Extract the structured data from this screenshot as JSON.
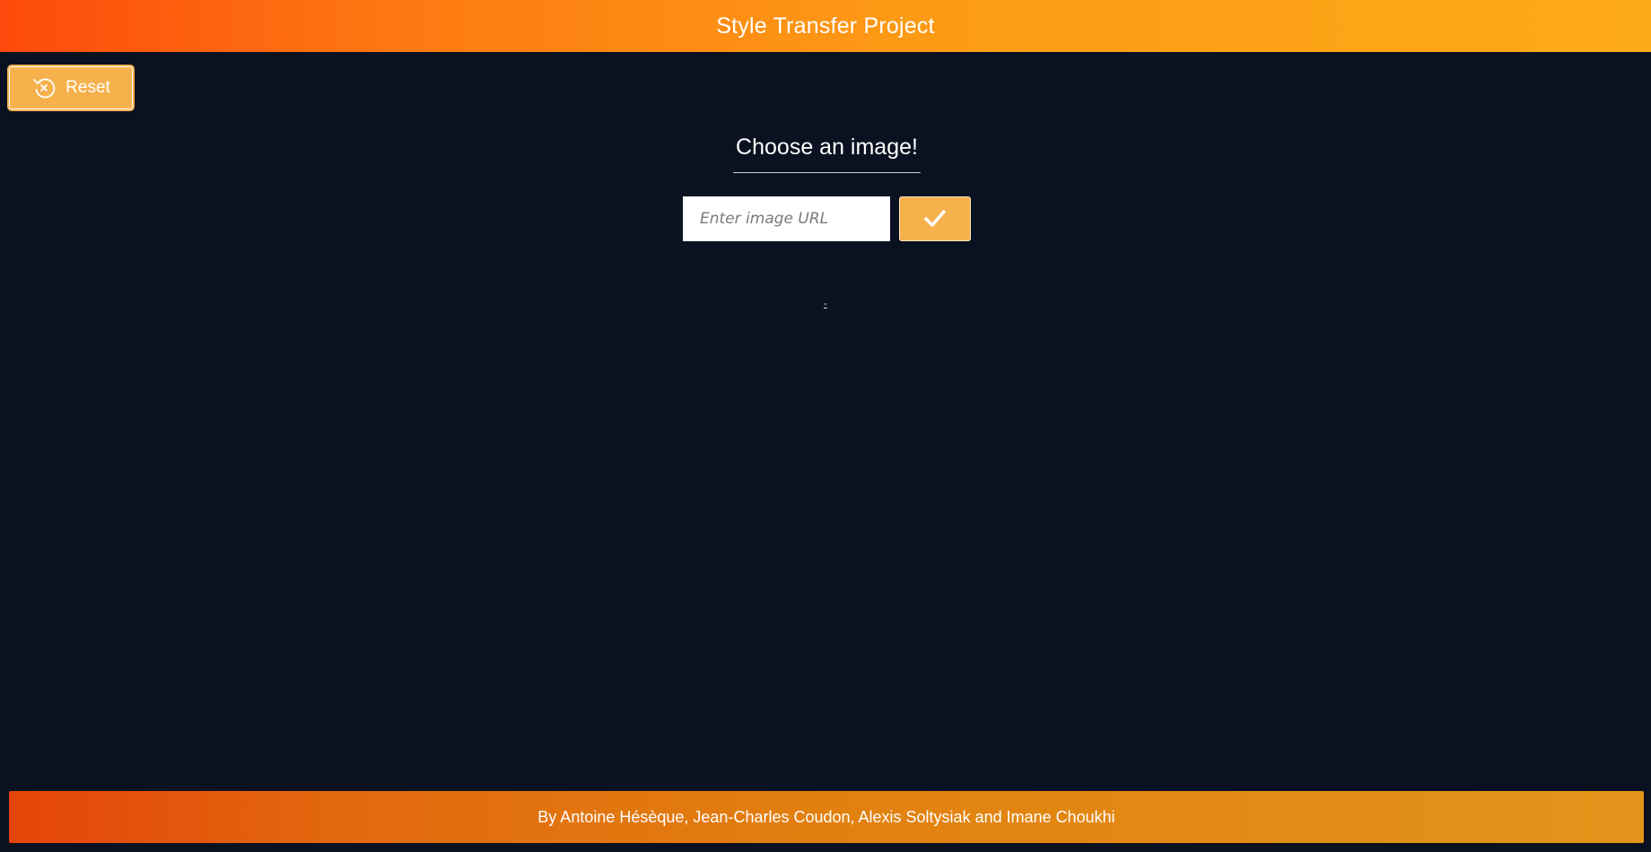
{
  "header": {
    "title": "Style Transfer Project",
    "gradient_start": "#fd4a0c",
    "gradient_end": "#fdaa18"
  },
  "toolbar": {
    "reset_label": "Reset",
    "reset_icon": "reset-icon"
  },
  "main": {
    "section_title": "Choose an image!",
    "url_input": {
      "placeholder": "Enter image URL",
      "value": ""
    },
    "submit_icon": "check-icon",
    "status_text": "-"
  },
  "footer": {
    "credit": "By Antoine Hésèque, Jean-Charles Coudon, Alexis Soltysiak and Imane Choukhi"
  },
  "colors": {
    "background": "#0a1120",
    "accent": "#f6b14c",
    "footer_start": "#e44409",
    "footer_end": "#e2951a"
  }
}
